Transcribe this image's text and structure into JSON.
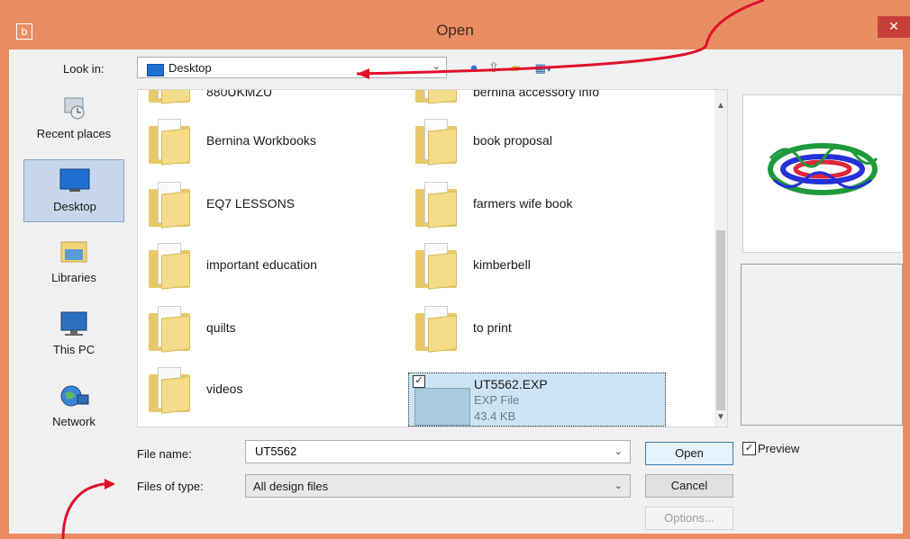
{
  "window": {
    "title": "Open",
    "app_icon_letter": "b",
    "close_glyph": "✕"
  },
  "look_in": {
    "label": "Look in:",
    "value": "Desktop"
  },
  "places": [
    {
      "label": "Recent places",
      "icon": "recent-places-icon"
    },
    {
      "label": "Desktop",
      "icon": "desktop-icon",
      "selected": true
    },
    {
      "label": "Libraries",
      "icon": "libraries-icon"
    },
    {
      "label": "This PC",
      "icon": "this-pc-icon"
    },
    {
      "label": "Network",
      "icon": "network-icon"
    }
  ],
  "files": [
    {
      "label": "Bernina Workbooks"
    },
    {
      "label": "book proposal"
    },
    {
      "label": "EQ7 LESSONS"
    },
    {
      "label": "farmers wife book"
    },
    {
      "label": "important education"
    },
    {
      "label": "kimberbell"
    },
    {
      "label": "quilts"
    },
    {
      "label": "to print"
    },
    {
      "label": "videos"
    }
  ],
  "selected_file": {
    "name": "UT5562.EXP",
    "type": "EXP File",
    "size": "43.4 KB"
  },
  "partial_top": {
    "left": "880UKMZU",
    "right": "bernina accessory info"
  },
  "file_name": {
    "label": "File name:",
    "value": "UT5562"
  },
  "file_type": {
    "label": "Files of type:",
    "value": "All design files"
  },
  "buttons": {
    "open": "Open",
    "cancel": "Cancel",
    "options": "Options..."
  },
  "preview": {
    "label": "Preview",
    "checked": true
  },
  "colors": {
    "title_bar": "#e98e63",
    "close": "#c7403a",
    "arrow": "#e0102a"
  }
}
